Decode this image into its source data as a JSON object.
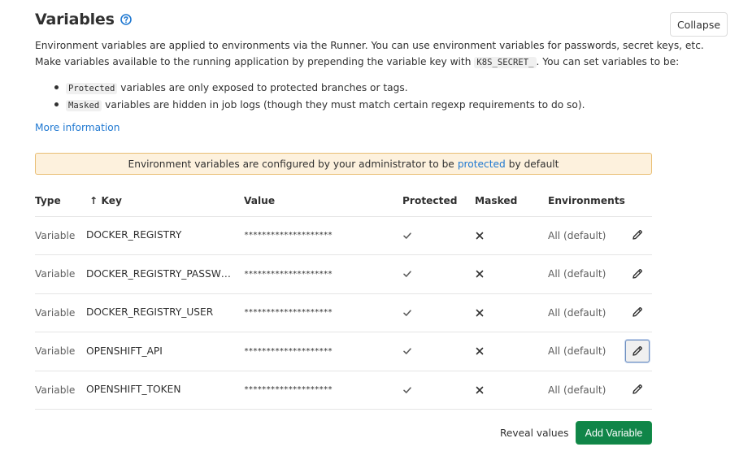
{
  "header": {
    "title": "Variables",
    "help_icon": "question-circle-icon",
    "collapse_label": "Collapse"
  },
  "description": {
    "line1": "Environment variables are applied to environments via the Runner. You can use environment variables for passwords, secret keys, etc.",
    "line2_before": "Make variables available to the running application by prepending the variable key with ",
    "line2_code": "K8S_SECRET_",
    "line2_after": ". You can set variables to be:"
  },
  "bullets": [
    {
      "code": "Protected",
      "text": " variables are only exposed to protected branches or tags."
    },
    {
      "code": "Masked",
      "text": " variables are hidden in job logs (though they must match certain regexp requirements to do so)."
    }
  ],
  "more_info_link": "More information",
  "alert": {
    "before": "Environment variables are configured by your administrator to be",
    "link": "protected",
    "after": "by default",
    "background_color": "#fdf1dd"
  },
  "table": {
    "headers": {
      "type": "Type",
      "key_sort_arrow": "↑",
      "key": "Key",
      "value": "Value",
      "protected": "Protected",
      "masked": "Masked",
      "environments": "Environments"
    },
    "rows": [
      {
        "type": "Variable",
        "key": "DOCKER_REGISTRY",
        "value": "********************",
        "protected_icon": "check-icon",
        "masked_icon": "close-icon",
        "environment": "All (default)",
        "edit_icon": "pencil-icon"
      },
      {
        "type": "Variable",
        "key": "DOCKER_REGISTRY_PASSWO...",
        "value": "********************",
        "protected_icon": "check-icon",
        "masked_icon": "close-icon",
        "environment": "All (default)",
        "edit_icon": "pencil-icon"
      },
      {
        "type": "Variable",
        "key": "DOCKER_REGISTRY_USER",
        "value": "********************",
        "protected_icon": "check-icon",
        "masked_icon": "close-icon",
        "environment": "All (default)",
        "edit_icon": "pencil-icon"
      },
      {
        "type": "Variable",
        "key": "OPENSHIFT_API",
        "value": "********************",
        "protected_icon": "check-icon",
        "masked_icon": "close-icon",
        "environment": "All (default)",
        "edit_icon": "pencil-icon",
        "edit_focused": true
      },
      {
        "type": "Variable",
        "key": "OPENSHIFT_TOKEN",
        "value": "********************",
        "protected_icon": "check-icon",
        "masked_icon": "close-icon",
        "environment": "All (default)",
        "edit_icon": "pencil-icon"
      }
    ]
  },
  "footer": {
    "reveal_label": "Reveal values",
    "add_label": "Add Variable",
    "add_color": "#108548"
  },
  "colors": {
    "link": "#1f78d1",
    "text": "#303030",
    "muted": "#5e5e5e"
  }
}
